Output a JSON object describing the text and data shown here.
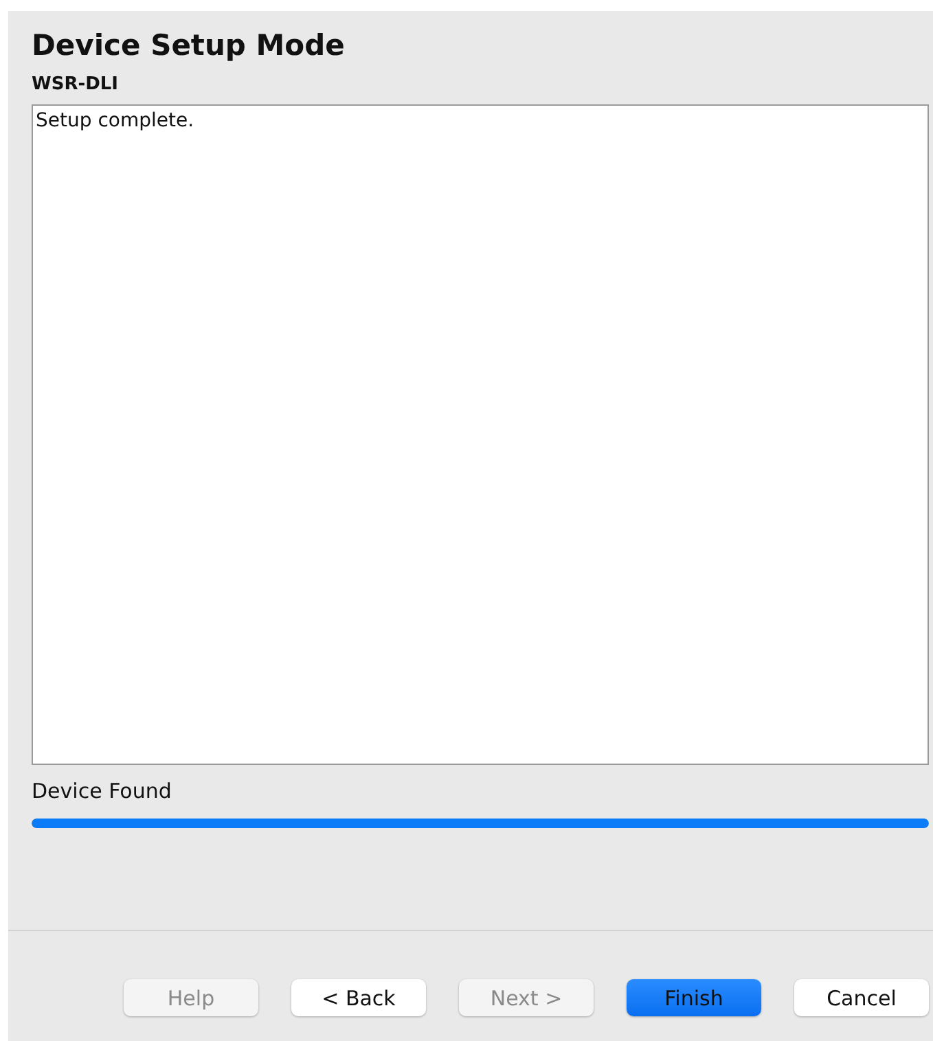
{
  "title": "Device Setup Mode",
  "subtitle": "WSR-DLI",
  "log": {
    "value": "Setup complete."
  },
  "status": {
    "label": "Device Found",
    "level": 1
  },
  "buttons": [
    {
      "label": "Help",
      "kind": "default",
      "disabled": true
    },
    {
      "label": "< Back",
      "kind": "default",
      "disabled": false
    },
    {
      "label": "Next >",
      "kind": "default",
      "disabled": true
    },
    {
      "label": "Finish",
      "kind": "primary",
      "disabled": false
    },
    {
      "label": "Cancel",
      "kind": "default",
      "disabled": false
    }
  ]
}
